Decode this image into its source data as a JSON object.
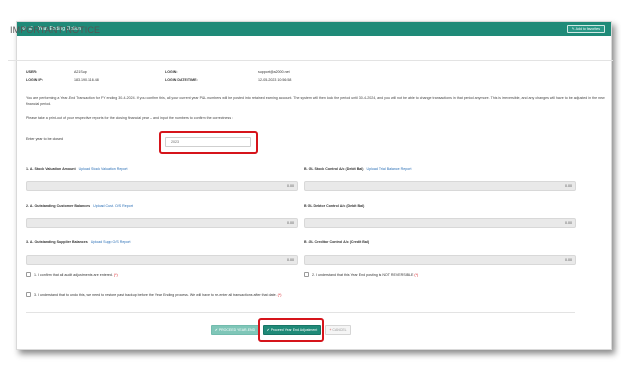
{
  "window": {
    "title": "Year Ending Option",
    "menu_icons": [
      "gear-icon",
      "hamburger-icon"
    ],
    "favourite_button": "Add to favorites"
  },
  "notice": {
    "title": "IMPORTANT NOTICE",
    "user_label": "USER:",
    "user_value": "A21Sup",
    "login_ip_label": "LOGIN IP:",
    "login_ip_value": "183.190.116.48",
    "login_label": "LOGIN:",
    "login_value": "support@a2000.net",
    "login_datetime_label": "LOGIN DATE/TIME:",
    "login_datetime_value": "12-05-2023 10:56:58",
    "paragraph1": "You are performing a Year-End Transaction for FY ending 30-4-2024. If you confirm this, all your current year P&L numbers will be posted into retained earning account. The system will then lock the period until 30-4-2024, and you will not be able to change transactions in that period anymore. This is irreversible, and any changes will have to be adjusted in the new financial period.",
    "paragraph2": "Please take a print-out of your respective reports for the closing financial year – and input the numbers to confirm the correctness :"
  },
  "year_field": {
    "label": "Enter year to be closed",
    "value": "2023"
  },
  "fields": {
    "stock_valuation": {
      "label": "1. A. Stock Valuation Amount",
      "link": "Upload Stock Valuation Report",
      "value": "0.00"
    },
    "stock_control": {
      "label": "B. GL Stock Control A/c (Debit Bal)",
      "link": "Upload Trial Balance Report",
      "value": "0.00"
    },
    "customer_balances": {
      "label": "2. A. Outstanding Customer Balances",
      "link": "Upload Cust. O/S Report",
      "value": "0.00"
    },
    "debtor_control": {
      "label": "B GL Debtor Control A/c (Debit Bal)",
      "link": "",
      "value": "0.00"
    },
    "supplier_balances": {
      "label": "3. A. Outstanding Supplier Balances",
      "link": "Upload Supp O/S Report",
      "value": "0.00"
    },
    "creditor_control": {
      "label": "B .GL Creditor Control A/c (Credit Bal)",
      "link": "",
      "value": "0.00"
    }
  },
  "checkboxes": {
    "c1": "1. I confirm that all audit adjustments are entered.",
    "c2": "2. I understand that this Year End posting is NOT REVERSIBLE",
    "c3": "3. I understand that to undo this, we need to restore past backup before the Year Ending process. We will have to re-enter all transactions after that date.",
    "required_mark": "(*)"
  },
  "buttons": {
    "proceed": "PROCEED YEAR-END",
    "proceed_adjustment": "Proceed Year End Adjustment",
    "cancel": "CANCEL"
  },
  "colors": {
    "header": "#1f8a78",
    "highlight": "#d6141b",
    "link": "#2a6fb6"
  }
}
